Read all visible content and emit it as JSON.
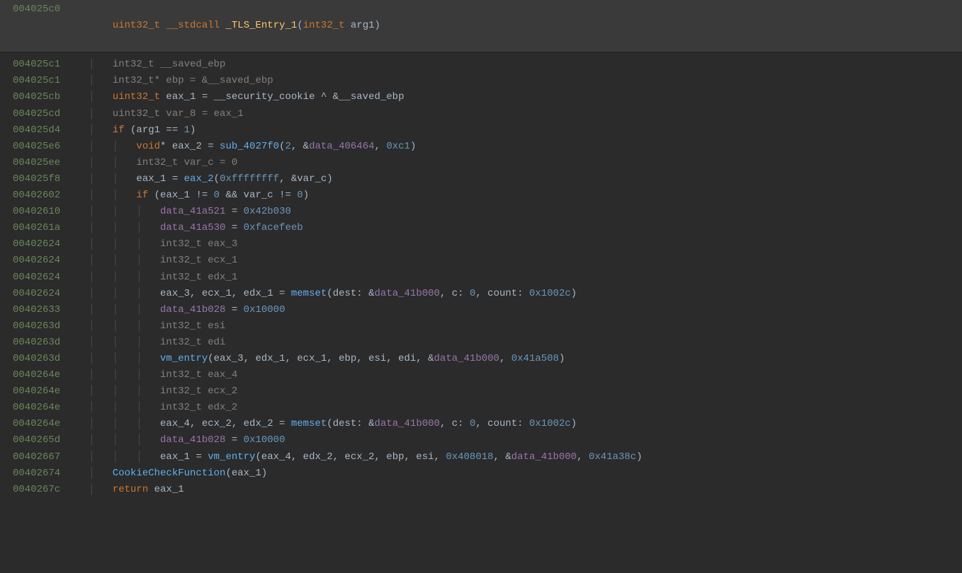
{
  "header": {
    "addr": "004025c0",
    "ret_type": "uint32_t",
    "callconv": "__stdcall",
    "name": "_TLS_Entry_1",
    "open": "(",
    "arg_type": "int32_t",
    "arg_name": " arg1",
    "close": ")"
  },
  "lines": [
    {
      "addr": "004025c1",
      "indent": 1,
      "spans": [
        {
          "c": "muted",
          "t": "int32_t __saved_ebp"
        }
      ]
    },
    {
      "addr": "004025c1",
      "indent": 1,
      "spans": [
        {
          "c": "muted",
          "t": "int32_t* ebp = &__saved_ebp"
        }
      ]
    },
    {
      "addr": "004025cb",
      "indent": 1,
      "spans": [
        {
          "c": "t-type",
          "t": "uint32_t"
        },
        {
          "c": "t-ident",
          "t": " eax_1 = __security_cookie ^ &__saved_ebp"
        }
      ]
    },
    {
      "addr": "004025cd",
      "indent": 1,
      "spans": [
        {
          "c": "muted",
          "t": "uint32_t var_8 = eax_1"
        }
      ]
    },
    {
      "addr": "004025d4",
      "indent": 1,
      "spans": [
        {
          "c": "t-kw",
          "t": "if"
        },
        {
          "c": "t-ident",
          "t": " (arg1 == "
        },
        {
          "c": "t-num",
          "t": "1"
        },
        {
          "c": "t-ident",
          "t": ")"
        }
      ]
    },
    {
      "addr": "004025e6",
      "indent": 2,
      "spans": [
        {
          "c": "t-type",
          "t": "void"
        },
        {
          "c": "t-ident",
          "t": "* eax_2 = "
        },
        {
          "c": "t-call",
          "t": "sub_4027f0"
        },
        {
          "c": "t-ident",
          "t": "("
        },
        {
          "c": "t-num",
          "t": "2"
        },
        {
          "c": "t-ident",
          "t": ", &"
        },
        {
          "c": "t-data",
          "t": "data_406464"
        },
        {
          "c": "t-ident",
          "t": ", "
        },
        {
          "c": "t-num",
          "t": "0xc1"
        },
        {
          "c": "t-ident",
          "t": ")"
        }
      ]
    },
    {
      "addr": "004025ee",
      "indent": 2,
      "spans": [
        {
          "c": "muted",
          "t": "int32_t var_c = 0"
        }
      ]
    },
    {
      "addr": "004025f8",
      "indent": 2,
      "spans": [
        {
          "c": "t-ident",
          "t": "eax_1 = "
        },
        {
          "c": "t-call",
          "t": "eax_2"
        },
        {
          "c": "t-ident",
          "t": "("
        },
        {
          "c": "t-num",
          "t": "0xffffffff"
        },
        {
          "c": "t-ident",
          "t": ", &var_c)"
        }
      ]
    },
    {
      "addr": "00402602",
      "indent": 2,
      "spans": [
        {
          "c": "t-kw",
          "t": "if"
        },
        {
          "c": "t-ident",
          "t": " (eax_1 != "
        },
        {
          "c": "t-num",
          "t": "0"
        },
        {
          "c": "t-ident",
          "t": " && var_c != "
        },
        {
          "c": "t-num",
          "t": "0"
        },
        {
          "c": "t-ident",
          "t": ")"
        }
      ]
    },
    {
      "addr": "00402610",
      "indent": 3,
      "spans": [
        {
          "c": "t-data",
          "t": "data_41a521"
        },
        {
          "c": "t-ident",
          "t": " = "
        },
        {
          "c": "t-num",
          "t": "0x42b030"
        }
      ]
    },
    {
      "addr": "0040261a",
      "indent": 3,
      "spans": [
        {
          "c": "t-data",
          "t": "data_41a530"
        },
        {
          "c": "t-ident",
          "t": " = "
        },
        {
          "c": "t-num",
          "t": "0xfacefeeb"
        }
      ]
    },
    {
      "addr": "00402624",
      "indent": 3,
      "spans": [
        {
          "c": "muted",
          "t": "int32_t eax_3"
        }
      ]
    },
    {
      "addr": "00402624",
      "indent": 3,
      "spans": [
        {
          "c": "muted",
          "t": "int32_t ecx_1"
        }
      ]
    },
    {
      "addr": "00402624",
      "indent": 3,
      "spans": [
        {
          "c": "muted",
          "t": "int32_t edx_1"
        }
      ]
    },
    {
      "addr": "00402624",
      "indent": 3,
      "spans": [
        {
          "c": "t-ident",
          "t": "eax_3, ecx_1, edx_1 = "
        },
        {
          "c": "t-call",
          "t": "memset"
        },
        {
          "c": "t-ident",
          "t": "(dest: &"
        },
        {
          "c": "t-data",
          "t": "data_41b000"
        },
        {
          "c": "t-ident",
          "t": ", c: "
        },
        {
          "c": "t-num",
          "t": "0"
        },
        {
          "c": "t-ident",
          "t": ", count: "
        },
        {
          "c": "t-num",
          "t": "0x1002c"
        },
        {
          "c": "t-ident",
          "t": ")"
        }
      ]
    },
    {
      "addr": "00402633",
      "indent": 3,
      "spans": [
        {
          "c": "t-data",
          "t": "data_41b028"
        },
        {
          "c": "t-ident",
          "t": " = "
        },
        {
          "c": "t-num",
          "t": "0x10000"
        }
      ]
    },
    {
      "addr": "0040263d",
      "indent": 3,
      "spans": [
        {
          "c": "muted",
          "t": "int32_t esi"
        }
      ]
    },
    {
      "addr": "0040263d",
      "indent": 3,
      "spans": [
        {
          "c": "muted",
          "t": "int32_t edi"
        }
      ]
    },
    {
      "addr": "0040263d",
      "indent": 3,
      "spans": [
        {
          "c": "t-call",
          "t": "vm_entry"
        },
        {
          "c": "t-ident",
          "t": "(eax_3, edx_1, ecx_1, ebp, esi, edi, &"
        },
        {
          "c": "t-data",
          "t": "data_41b000"
        },
        {
          "c": "t-ident",
          "t": ", "
        },
        {
          "c": "t-num",
          "t": "0x41a508"
        },
        {
          "c": "t-ident",
          "t": ")"
        }
      ]
    },
    {
      "addr": "0040264e",
      "indent": 3,
      "spans": [
        {
          "c": "muted",
          "t": "int32_t eax_4"
        }
      ]
    },
    {
      "addr": "0040264e",
      "indent": 3,
      "spans": [
        {
          "c": "muted",
          "t": "int32_t ecx_2"
        }
      ]
    },
    {
      "addr": "0040264e",
      "indent": 3,
      "spans": [
        {
          "c": "muted",
          "t": "int32_t edx_2"
        }
      ]
    },
    {
      "addr": "0040264e",
      "indent": 3,
      "spans": [
        {
          "c": "t-ident",
          "t": "eax_4, ecx_2, edx_2 = "
        },
        {
          "c": "t-call",
          "t": "memset"
        },
        {
          "c": "t-ident",
          "t": "(dest: &"
        },
        {
          "c": "t-data",
          "t": "data_41b000"
        },
        {
          "c": "t-ident",
          "t": ", c: "
        },
        {
          "c": "t-num",
          "t": "0"
        },
        {
          "c": "t-ident",
          "t": ", count: "
        },
        {
          "c": "t-num",
          "t": "0x1002c"
        },
        {
          "c": "t-ident",
          "t": ")"
        }
      ]
    },
    {
      "addr": "0040265d",
      "indent": 3,
      "spans": [
        {
          "c": "t-data",
          "t": "data_41b028"
        },
        {
          "c": "t-ident",
          "t": " = "
        },
        {
          "c": "t-num",
          "t": "0x10000"
        }
      ]
    },
    {
      "addr": "00402667",
      "indent": 3,
      "spans": [
        {
          "c": "t-ident",
          "t": "eax_1 = "
        },
        {
          "c": "t-call",
          "t": "vm_entry"
        },
        {
          "c": "t-ident",
          "t": "(eax_4, edx_2, ecx_2, ebp, esi, "
        },
        {
          "c": "t-num",
          "t": "0x408018"
        },
        {
          "c": "t-ident",
          "t": ", &"
        },
        {
          "c": "t-data",
          "t": "data_41b000"
        },
        {
          "c": "t-ident",
          "t": ", "
        },
        {
          "c": "t-num",
          "t": "0x41a38c"
        },
        {
          "c": "t-ident",
          "t": ")"
        }
      ]
    },
    {
      "addr": "00402674",
      "indent": 1,
      "spans": [
        {
          "c": "t-call",
          "t": "CookieCheckFunction"
        },
        {
          "c": "t-ident",
          "t": "(eax_1)"
        }
      ]
    },
    {
      "addr": "0040267c",
      "indent": 1,
      "spans": [
        {
          "c": "t-kw",
          "t": "return"
        },
        {
          "c": "t-ident",
          "t": " eax_1"
        }
      ]
    }
  ]
}
